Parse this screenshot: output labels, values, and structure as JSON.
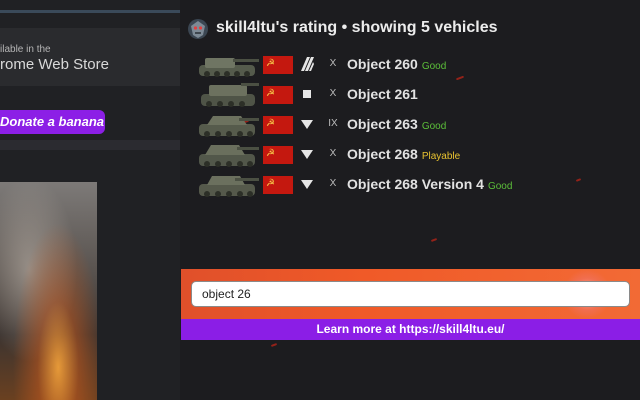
{
  "background_page": {
    "store_badge": {
      "line1": "ilable in the",
      "line2": "rome Web Store"
    },
    "donate_label": "Donate a banana"
  },
  "popup": {
    "title": "skill4ltu's rating • showing 5 vehicles",
    "vehicles": [
      {
        "name": "Object 260",
        "tier": "X",
        "class_icon": "heavy-tank-class-icon",
        "rating": "Good",
        "rating_color": "#5cbf3a",
        "nation": "USSR"
      },
      {
        "name": "Object 261",
        "tier": "X",
        "class_icon": "spg-class-icon",
        "rating": "",
        "rating_color": "",
        "nation": "USSR"
      },
      {
        "name": "Object 263",
        "tier": "IX",
        "class_icon": "tank-destroyer-class-icon",
        "rating": "Good",
        "rating_color": "#5cbf3a",
        "nation": "USSR"
      },
      {
        "name": "Object 268",
        "tier": "X",
        "class_icon": "tank-destroyer-class-icon",
        "rating": "Playable",
        "rating_color": "#e7c230",
        "nation": "USSR"
      },
      {
        "name": "Object 268 Version 4",
        "tier": "X",
        "class_icon": "tank-destroyer-class-icon",
        "rating": "Good",
        "rating_color": "#5cbf3a",
        "nation": "USSR"
      }
    ],
    "search": {
      "value": "object 26",
      "placeholder": ""
    },
    "learn_more_label": "Learn more at https://skill4ltu.eu/"
  },
  "colors": {
    "accent_purple": "#8b1ee6",
    "accent_orange": "#f05a28",
    "popup_bg": "#1c1c1f",
    "good": "#5cbf3a",
    "playable": "#e7c230"
  }
}
